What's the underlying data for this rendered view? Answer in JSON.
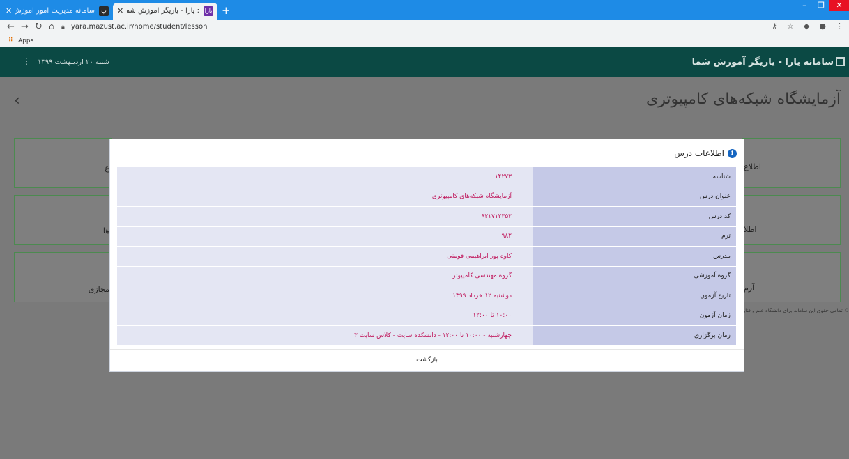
{
  "browser": {
    "tabs": [
      {
        "label": "سامانه مدیریت امور آموزش",
        "favicon": "پ",
        "active": false
      },
      {
        "label": ": یارا - یاریگر آموزش شما",
        "favicon": "یارا",
        "active": true
      }
    ],
    "url": "yara.mazust.ac.ir/home/student/lesson",
    "bookmarks_apps_label": "Apps"
  },
  "header": {
    "title": "سامانه یارا - یاریگر آموزش شما",
    "date": "شنبه ۲۰ اردیبهشت ۱۳۹۹"
  },
  "page": {
    "title": "آزمایشگاه شبکه‌های کامپیوتری",
    "card_fragments": {
      "right_1": "اطلاع",
      "right_2": "اطلا",
      "right_3": "آزم",
      "left_1": "ع",
      "left_2": "ها",
      "left_3": "مجازی"
    },
    "footer_note": "© تمامی حقوق این سامانه برای دانشگاه علم و فناوری مازندران محفوظ است"
  },
  "modal": {
    "title": "اطلاعات درس",
    "rows": [
      {
        "label": "شناسه",
        "value": "۱۴۲۷۳"
      },
      {
        "label": "عنوان درس",
        "value": "آزمایشگاه شبکه‌های کامپیوتری"
      },
      {
        "label": "کد درس",
        "value": "۹۲۱۷۱۲۳۵۲"
      },
      {
        "label": "ترم",
        "value": "۹۸۲"
      },
      {
        "label": "مدرس",
        "value": "کاوه پور ابراهیمی فومنی"
      },
      {
        "label": "گروه آموزشی",
        "value": "گروه مهندسی کامپیوتر"
      },
      {
        "label": "تاریخ آزمون",
        "value": "دوشنبه ۱۲ خرداد ۱۳۹۹"
      },
      {
        "label": "زمان آزمون",
        "value": "۱۰:۰۰ تا ۱۲:۰۰"
      },
      {
        "label": "زمان برگزاری",
        "value": "چهارشنبه - ۱۰:۰۰ تا ۱۲:۰۰ - دانشکده سایت - کلاس سایت ۳"
      }
    ],
    "return_label": "بازگشت"
  },
  "colors": {
    "header_bg": "#0b4944",
    "label_bg": "#c5c9e7",
    "value_bg": "#e4e6f3",
    "value_text": "#c0185c",
    "info_icon": "#1565c0"
  }
}
